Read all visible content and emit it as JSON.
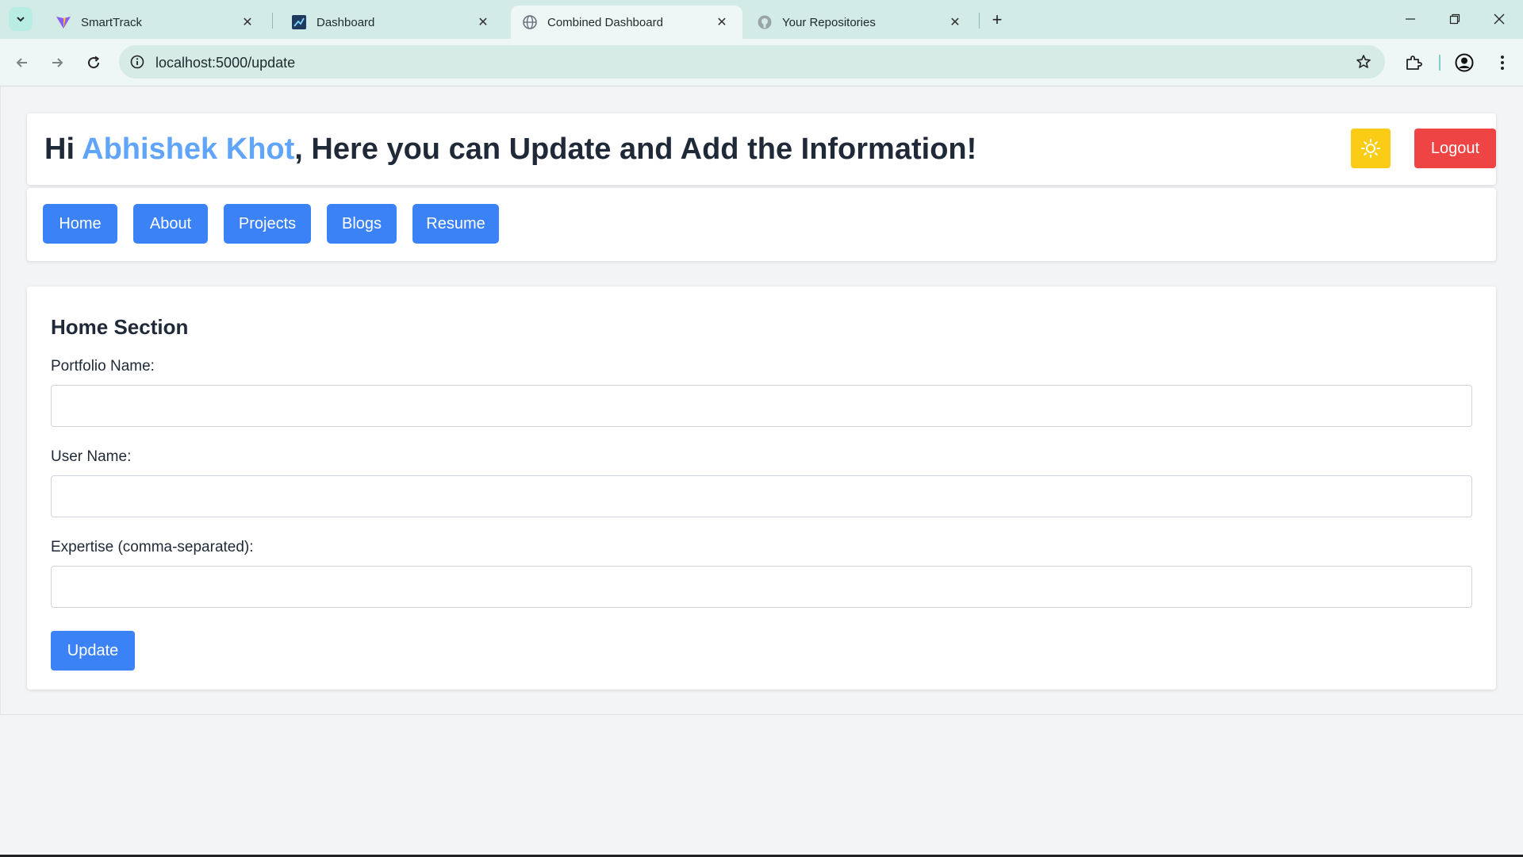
{
  "browser": {
    "tabs": [
      {
        "title": "SmartTrack",
        "active": false,
        "favicon": "vite-logo-icon"
      },
      {
        "title": "Dashboard",
        "active": false,
        "favicon": "dashboard-favicon-icon"
      },
      {
        "title": "Combined Dashboard",
        "active": true,
        "favicon": "globe-icon"
      },
      {
        "title": "Your Repositories",
        "active": false,
        "favicon": "github-icon"
      }
    ],
    "url": "localhost:5000/update"
  },
  "header": {
    "greeting_prefix": "Hi ",
    "user_name": "Abhishek Khot",
    "greeting_suffix": ", Here you can Update and Add the Information!",
    "logout_label": "Logout",
    "theme_icon": "sun-icon"
  },
  "nav": {
    "items": [
      {
        "label": "Home"
      },
      {
        "label": "About"
      },
      {
        "label": "Projects"
      },
      {
        "label": "Blogs"
      },
      {
        "label": "Resume"
      }
    ]
  },
  "form": {
    "section_title": "Home Section",
    "fields": [
      {
        "label": "Portfolio Name:",
        "value": ""
      },
      {
        "label": "User Name:",
        "value": ""
      },
      {
        "label": "Expertise (comma-separated):",
        "value": ""
      }
    ],
    "submit_label": "Update"
  },
  "colors": {
    "primary": "#3b82f6",
    "danger": "#ef4444",
    "warning": "#facc15",
    "name_accent": "#60a5fa",
    "tabstrip": "#d3ebe6"
  }
}
